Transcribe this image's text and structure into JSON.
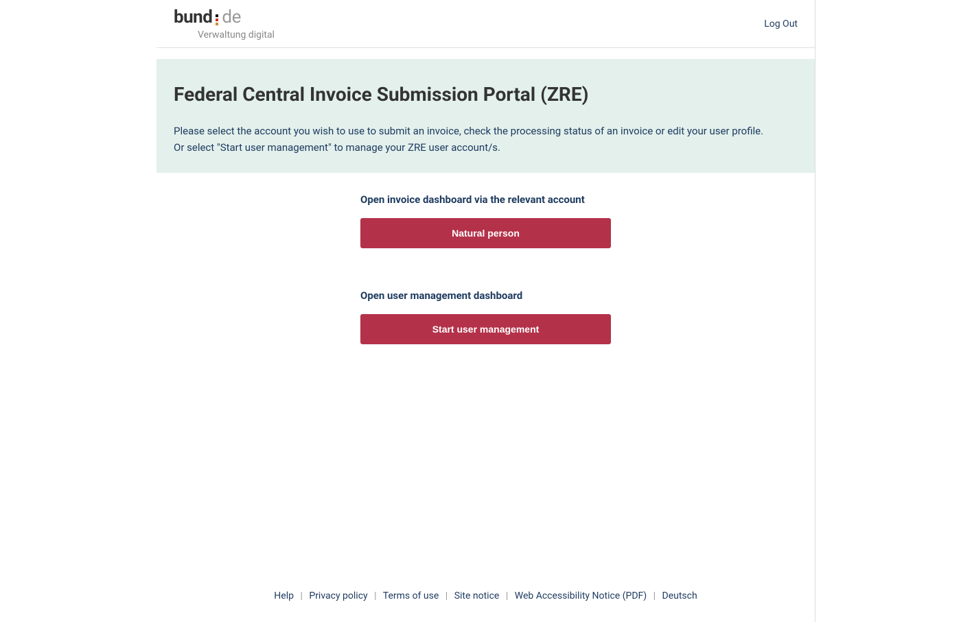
{
  "header": {
    "logo_bund": "bund",
    "logo_de": "de",
    "logo_sub": "Verwaltung digital",
    "logout": "Log Out"
  },
  "banner": {
    "title": "Federal Central Invoice Submission Portal (ZRE)",
    "line1": "Please select the account you wish to use to submit an invoice, check the processing status of an invoice or edit your user profile.",
    "line2": "Or select \"Start user management\" to manage your ZRE user account/s."
  },
  "content": {
    "section1_heading": "Open invoice dashboard via the relevant account",
    "button1_label": "Natural person",
    "section2_heading": "Open user management dashboard",
    "button2_label": "Start user management"
  },
  "footer": {
    "links": [
      "Help",
      "Privacy policy",
      "Terms of use",
      "Site notice",
      "Web Accessibility Notice (PDF)",
      "Deutsch"
    ]
  }
}
